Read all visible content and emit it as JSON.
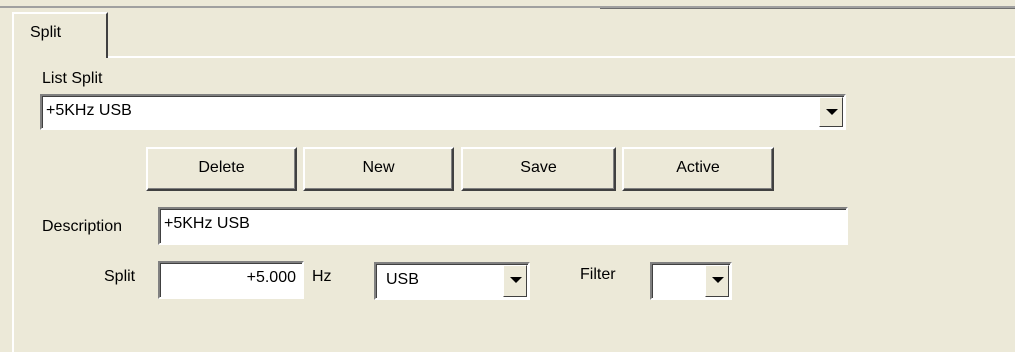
{
  "tab": {
    "label": "Split"
  },
  "list_split": {
    "label": "List Split",
    "selected": "+5KHz USB"
  },
  "buttons": {
    "delete": "Delete",
    "new": "New",
    "save": "Save",
    "active": "Active"
  },
  "description": {
    "label": "Description",
    "value": "+5KHz USB"
  },
  "split": {
    "label": "Split",
    "value": "+5.000",
    "unit": "Hz",
    "mode_selected": "USB"
  },
  "filter": {
    "label": "Filter",
    "selected": ""
  }
}
